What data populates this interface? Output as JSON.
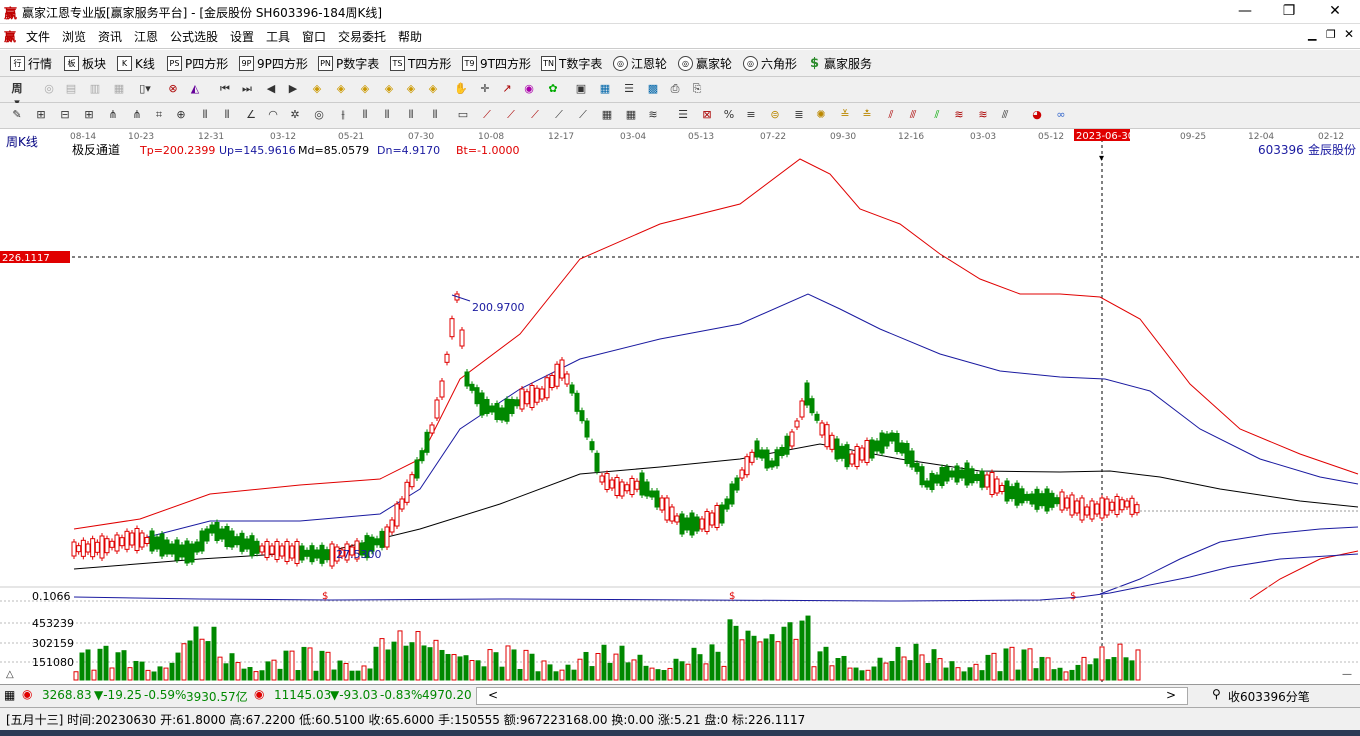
{
  "window": {
    "logo": "赢",
    "title": "赢家江恩专业版[赢家服务平台] - [金辰股份   SH603396-184周K线]",
    "minimize": "—",
    "restore": "❐",
    "close": "✕"
  },
  "menu": {
    "logo": "赢",
    "items": [
      "文件",
      "浏览",
      "资讯",
      "江恩",
      "公式选股",
      "设置",
      "工具",
      "窗口",
      "交易委托",
      "帮助"
    ]
  },
  "toolbar1": {
    "items": [
      {
        "icon": "行",
        "label": "行情"
      },
      {
        "icon": "板",
        "label": "板块"
      },
      {
        "icon": "K",
        "label": "K线"
      },
      {
        "icon": "PS",
        "label": "P四方形"
      },
      {
        "icon": "9P",
        "label": "9P四方形"
      },
      {
        "icon": "PN",
        "label": "P数字表"
      },
      {
        "icon": "TS",
        "label": "T四方形"
      },
      {
        "icon": "T9",
        "label": "9T四方形"
      },
      {
        "icon": "TN",
        "label": "T数字表"
      },
      {
        "icon": "◎",
        "label": "江恩轮"
      },
      {
        "icon": "◎",
        "label": "赢家轮"
      },
      {
        "icon": "◎",
        "label": "六角形"
      },
      {
        "icon": "$",
        "label": "赢家服务"
      }
    ]
  },
  "chart": {
    "panel_label": "周K线",
    "indicator_name": "极反通道",
    "tp": "Tp=200.2399",
    "up": "Up=145.9616",
    "md": "Md=85.0579",
    "dn": "Dn=4.9170",
    "bt": "Bt=-1.0000",
    "stock_code": "603396",
    "stock_name": "金辰股份",
    "cursor_price": "226.1117",
    "cursor_date": "2023-06-30",
    "high_label": "200.9700",
    "low_label": "27.5300",
    "dates": [
      "08-14",
      "10-23",
      "12-31",
      "03-12",
      "05-21",
      "07-30",
      "10-08",
      "12-17",
      "03-04",
      "05-13",
      "07-22",
      "09-30",
      "12-16",
      "03-03",
      "05-12",
      "2023-06-30",
      "09-25",
      "12-04",
      "02-12"
    ],
    "sub_label": "0.1066",
    "vol_labels": [
      "453239",
      "302159",
      "151080"
    ],
    "signal": "$",
    "colors": {
      "up": "#e00000",
      "down": "#008800",
      "tp": "#e00000",
      "up_line": "#1a1aa0",
      "md": "#000000",
      "cursor": "#e00000"
    }
  },
  "bottom": {
    "sh_index": "3268.83",
    "sh_change": "▼-19.25",
    "sh_pct": "-0.59%",
    "sh_amount": "3930.57亿",
    "sz_index": "11145.03",
    "sz_change": "▼-93.03",
    "sz_pct": "-0.83%",
    "sz_amount": "4970.20",
    "scroll_left": "<",
    "scroll_right": ">",
    "chart_tab": "收603396分笔"
  },
  "status": {
    "text": "[五月十三] 时间:20230630 开:61.8000 高:67.2200 低:60.5100 收:65.6000 手:150555 额:967223168.00 换:0.00 涨:5.21 盘:0 标:226.1117"
  }
}
